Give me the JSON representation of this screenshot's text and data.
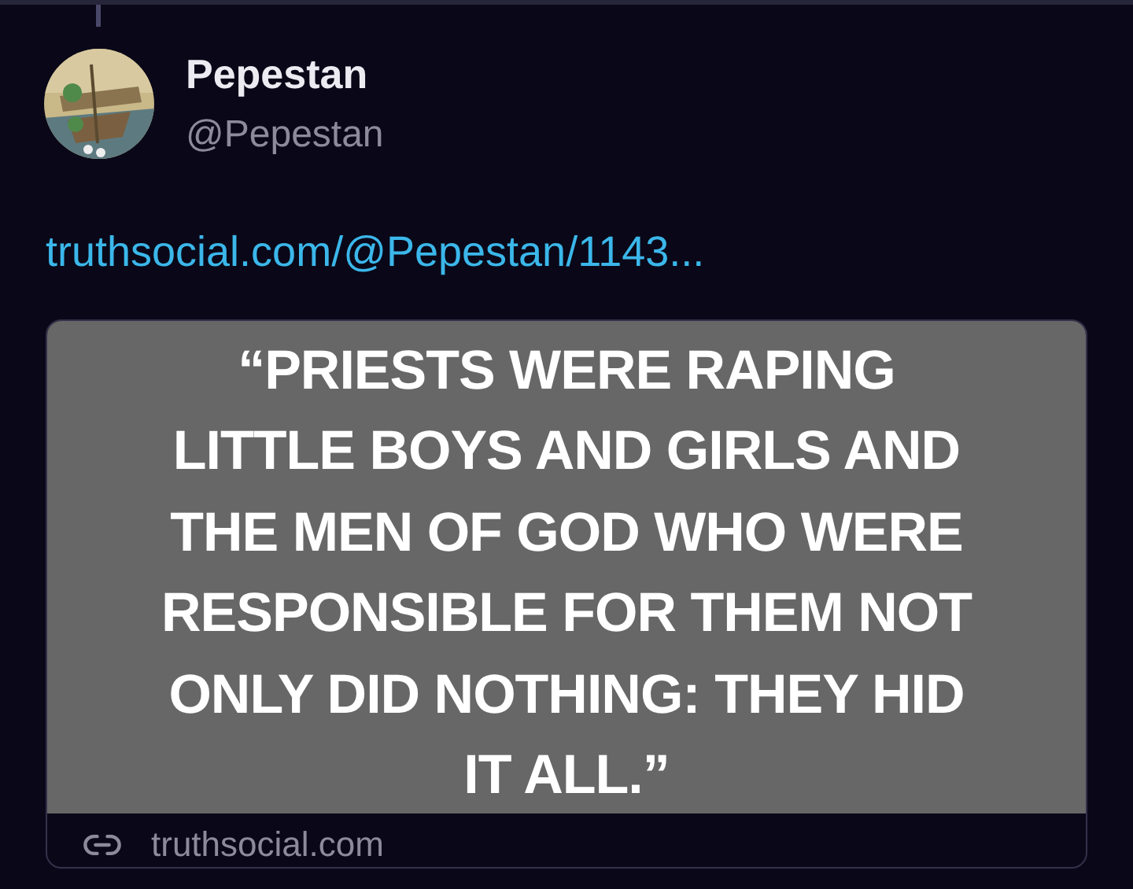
{
  "post": {
    "author": {
      "name": "Pepestan",
      "handle": "@Pepestan"
    },
    "link": "truthsocial.com/@Pepestan/1143...",
    "card": {
      "image_text": [
        "“PRIESTS WERE RAPING",
        "LITTLE BOYS AND GIRLS AND",
        "THE MEN OF GOD WHO WERE",
        "RESPONSIBLE FOR THEM NOT",
        "ONLY DID NOTHING: THEY HID",
        "IT ALL.”"
      ],
      "domain": "truthsocial.com"
    }
  }
}
